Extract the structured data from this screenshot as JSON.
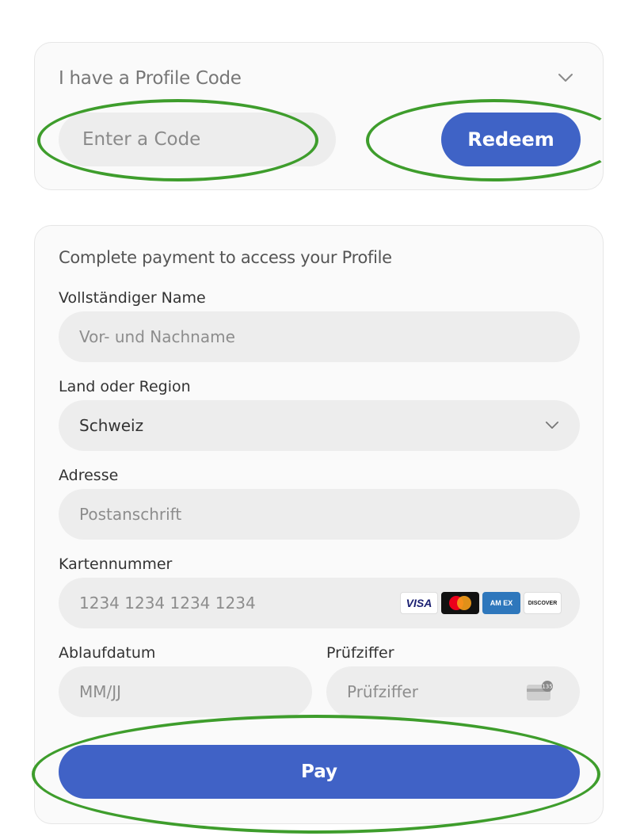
{
  "profile_code": {
    "title": "I have a Profile Code",
    "code_placeholder": "Enter a Code",
    "redeem_label": "Redeem"
  },
  "payment": {
    "title": "Complete payment to access your Profile",
    "name": {
      "label": "Vollständiger Name",
      "placeholder": "Vor- und Nachname"
    },
    "country": {
      "label": "Land oder Region",
      "value": "Schweiz"
    },
    "address": {
      "label": "Adresse",
      "placeholder": "Postanschrift"
    },
    "card": {
      "label": "Kartennummer",
      "placeholder": "1234 1234 1234 1234",
      "brands": [
        "VISA",
        "AM EX",
        "DISCOVER"
      ]
    },
    "expiry": {
      "label": "Ablaufdatum",
      "placeholder": "MM/JJ"
    },
    "cvc": {
      "label": "Prüfziffer",
      "placeholder": "Prüfziffer",
      "icon_digits": "135"
    },
    "pay_label": "Pay"
  },
  "colors": {
    "accent": "#4062c6",
    "annotation": "#3e9d2c",
    "field_bg": "#ededed"
  },
  "icons": [
    "chevron-down-icon",
    "visa-icon",
    "mastercard-icon",
    "amex-icon",
    "discover-icon",
    "cvc-card-icon"
  ]
}
